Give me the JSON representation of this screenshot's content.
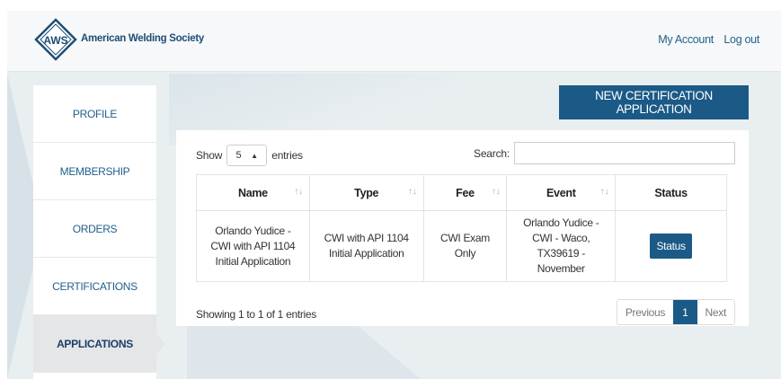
{
  "header": {
    "logo_text": "AWS",
    "org_name": "American Welding Society",
    "links": [
      "My Account",
      "Log out"
    ]
  },
  "sidebar": {
    "items": [
      {
        "label": "PROFILE",
        "active": false
      },
      {
        "label": "MEMBERSHIP",
        "active": false
      },
      {
        "label": "ORDERS",
        "active": false
      },
      {
        "label": "CERTIFICATIONS",
        "active": false
      },
      {
        "label": "APPLICATIONS",
        "active": true
      }
    ]
  },
  "actions": {
    "new_cert_label": "NEW CERTIFICATION APPLICATION"
  },
  "table_controls": {
    "show_label": "Show",
    "entries_value": "5",
    "entries_label": "entries",
    "search_label": "Search:",
    "search_value": ""
  },
  "table": {
    "columns": [
      "Name",
      "Type",
      "Fee",
      "Event",
      "Status"
    ],
    "rows": [
      {
        "name": "Orlando Yudice - CWI with API 1104 Initial Application",
        "type": "CWI with API 1104 Initial Application",
        "fee": "CWI Exam Only",
        "event": "Orlando Yudice - CWI - Waco, TX39619 - November",
        "status_label": "Status"
      }
    ]
  },
  "footer": {
    "info": "Showing 1 to 1 of 1 entries",
    "prev_label": "Previous",
    "page": "1",
    "next_label": "Next"
  },
  "colors": {
    "brand": "#1b5a86",
    "link": "#1f5f8b",
    "background": "#e9eef1"
  }
}
